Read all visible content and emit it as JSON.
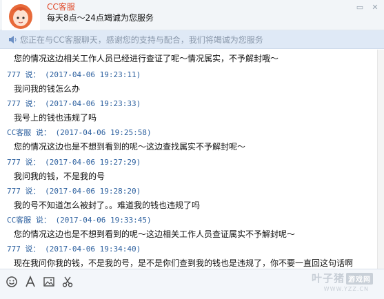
{
  "header": {
    "contact_name": "CC客服",
    "signature": "每天8点～24点竭诚为您服务"
  },
  "notice": {
    "text": "您正在与CC客服聊天，感谢您的支持与配合，我们将竭诚为您服务"
  },
  "messages": [
    {
      "sender": "",
      "time": "",
      "text": "您的情况这边相关工作人员已经进行查证了呢～情况属实，不予解封哦～"
    },
    {
      "sender": "777",
      "sep": "说：",
      "time": "(2017-04-06 19:23:11)",
      "text": "我问我的钱怎么办"
    },
    {
      "sender": "777",
      "sep": "说：",
      "time": "(2017-04-06 19:23:33)",
      "text": "我号上的钱也违规了吗"
    },
    {
      "sender": "CC客服",
      "sep": "说：",
      "time": "(2017-04-06 19:25:58)",
      "text": "您的情况这边也是不想到看到的呢～这边查找属实不予解封呢～"
    },
    {
      "sender": "777",
      "sep": "说：",
      "time": "(2017-04-06 19:27:29)",
      "text": "我问我的钱，不是我的号"
    },
    {
      "sender": "777",
      "sep": "说：",
      "time": "(2017-04-06 19:28:20)",
      "text": "我的号不知道怎么被封了。。难道我的钱也违规了吗"
    },
    {
      "sender": "CC客服",
      "sep": "说：",
      "time": "(2017-04-06 19:33:45)",
      "text": "您的情况这边也是不想到看到的呢～这边相关工作人员查证属实不予解封呢～"
    },
    {
      "sender": "777",
      "sep": "说：",
      "time": "(2017-04-06 19:34:40)",
      "text": "现在我问你我的钱，不是我的号，是不是你们查到我的钱也是违规了，你不要一直回这句话啊"
    }
  ],
  "toolbar": {
    "icons": [
      "emoji-icon",
      "font-icon",
      "image-icon",
      "screenshot-icon"
    ]
  },
  "watermark": {
    "brand": "叶子猪",
    "tag": "游戏网",
    "url": "WWW.YZZ.CN"
  },
  "colors": {
    "sender_blue": "#2b5f9e",
    "contact_red": "#e04a2a",
    "notice_bg": "#dfe9f6"
  }
}
